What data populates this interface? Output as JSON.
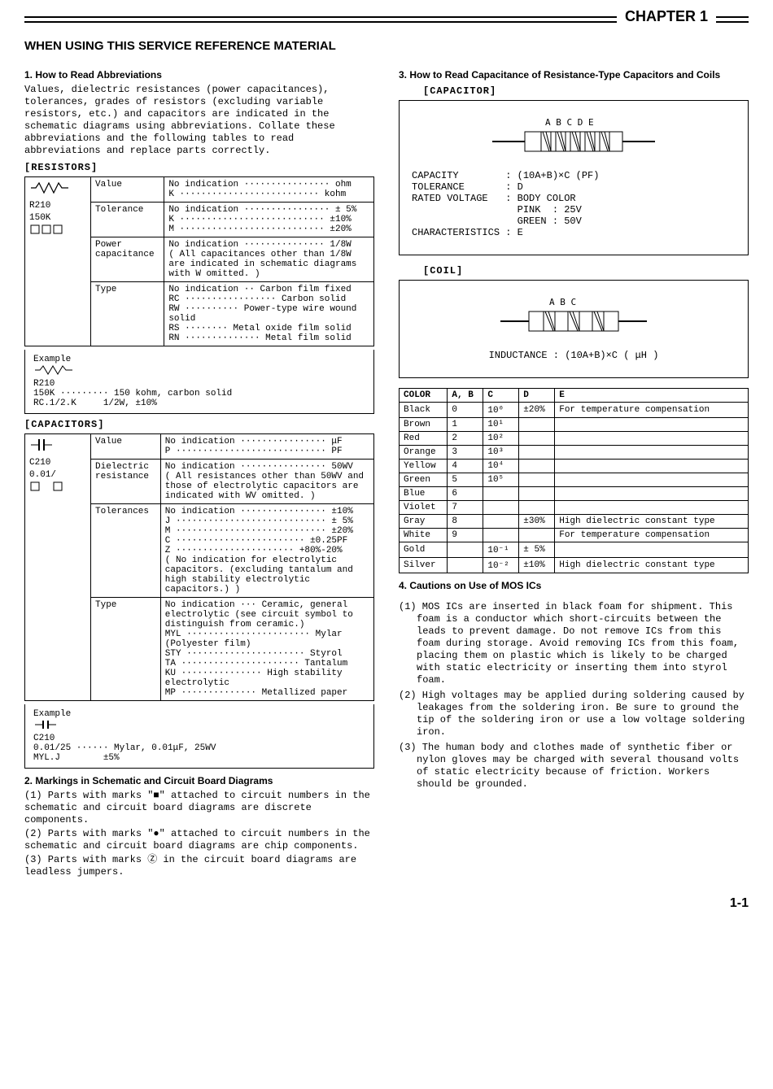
{
  "chapter": "CHAPTER 1",
  "main_title": "WHEN USING THIS SERVICE REFERENCE MATERIAL",
  "sec1": {
    "heading": "1. How to Read Abbreviations",
    "intro": "Values, dielectric resistances (power capacitances), tolerances, grades of resistors (excluding variable resistors, etc.) and capacitors are indicated in the schematic diagrams using abbreviations. Collate these abbreviations and the following tables to read abbreviations and replace parts correctly.",
    "resistors_label": "[RESISTORS]",
    "resistors_symbol": "R210\n150K",
    "resistors_rows": [
      {
        "k": "Value",
        "v": "No indication ················ ohm\nK ·························· kohm"
      },
      {
        "k": "Tolerance",
        "v": "No indication ················ ± 5%\nK ··························· ±10%\nM ··························· ±20%"
      },
      {
        "k": "Power capacitance",
        "v": "No indication ··············· 1/8W\n( All capacitances other than 1/8W are indicated in schematic diagrams with W omitted. )"
      },
      {
        "k": "Type",
        "v": "No indication ·· Carbon film fixed\nRC ················· Carbon solid\nRW ·········· Power-type wire wound solid\nRS ········ Metal oxide film solid\nRN ·············· Metal film solid"
      }
    ],
    "resistors_example_label": "Example",
    "resistors_example": "R210\n150K ········· 150 kohm, carbon solid\nRC.1/2.K     1/2W, ±10%",
    "capacitors_label": "[CAPACITORS]",
    "capacitors_symbol": "C210\n0.01/",
    "capacitors_rows": [
      {
        "k": "Value",
        "v": "No indication ················ μF\nP ···························· PF"
      },
      {
        "k": "Dielectric resistance",
        "v": "No indication ················ 50WV\n( All resistances other than 50WV and those of electrolytic capacitors are indicated with WV omitted. )"
      },
      {
        "k": "Tolerances",
        "v": "No indication ················ ±10%\nJ ···························· ± 5%\nM ···························· ±20%\nC ························ ±0.25PF\nZ ······················ +80%-20%\n( No indication for electrolytic capacitors. (excluding tantalum and high stability electrolytic capacitors.) )"
      },
      {
        "k": "Type",
        "v": "No indication ··· Ceramic, general electrolytic (see circuit symbol to distinguish from ceramic.)\nMYL ······················· Mylar (Polyester film)\nSTY ······················ Styrol\nTA ······················ Tantalum\nKU ··············· High stability electrolytic\nMP ·············· Metallized paper"
      }
    ],
    "capacitors_example_label": "Example",
    "capacitors_example": "C210\n0.01/25 ······ Mylar, 0.01μF, 25WV\nMYL.J        ±5%"
  },
  "sec2": {
    "heading": "2. Markings in Schematic and Circuit Board Diagrams",
    "items": [
      "(1) Parts with marks \"■\" attached to circuit numbers in the schematic and circuit board diagrams are discrete components.",
      "(2) Parts with marks \"●\" attached to circuit numbers in the schematic and circuit board diagrams are chip components.",
      "(3) Parts with marks Ⓩ in the circuit board diagrams are leadless jumpers."
    ]
  },
  "sec3": {
    "heading": "3. How to Read Capacitance of Resistance-Type Capacitors and Coils",
    "cap_label": "[CAPACITOR]",
    "cap_letters": [
      "A",
      "B",
      "C",
      "D",
      "E"
    ],
    "cap_lines": [
      "CAPACITY        : (10A+B)×C (PF)",
      "TOLERANCE       : D",
      "RATED VOLTAGE   : BODY COLOR",
      "                  PINK  : 25V",
      "                  GREEN : 50V",
      "CHARACTERISTICS : E"
    ],
    "coil_label": "[COIL]",
    "coil_letters": [
      "A",
      "B",
      "C"
    ],
    "coil_line": "INDUCTANCE : (10A+B)×C ( μH )",
    "color_table": {
      "headers": [
        "COLOR",
        "A, B",
        "C",
        "D",
        "E"
      ],
      "rows": [
        [
          "Black",
          "0",
          "10⁰",
          "±20%",
          "For temperature compensation"
        ],
        [
          "Brown",
          "1",
          "10¹",
          "",
          ""
        ],
        [
          "Red",
          "2",
          "10²",
          "",
          ""
        ],
        [
          "Orange",
          "3",
          "10³",
          "",
          ""
        ],
        [
          "Yellow",
          "4",
          "10⁴",
          "",
          ""
        ],
        [
          "Green",
          "5",
          "10⁵",
          "",
          ""
        ],
        [
          "Blue",
          "6",
          "",
          "",
          ""
        ],
        [
          "Violet",
          "7",
          "",
          "",
          ""
        ],
        [
          "Gray",
          "8",
          "",
          "±30%",
          "High dielectric constant type"
        ],
        [
          "White",
          "9",
          "",
          "",
          "For temperature compensation"
        ],
        [
          "Gold",
          "",
          "10⁻¹",
          "± 5%",
          ""
        ],
        [
          "Silver",
          "",
          "10⁻²",
          "±10%",
          "High dielectric constant type"
        ]
      ]
    }
  },
  "sec4": {
    "heading": "4. Cautions on Use of MOS ICs",
    "items": [
      "(1) MOS ICs are inserted in black foam for shipment. This foam is a conductor which short-circuits between the leads to prevent damage. Do not remove ICs from this foam during storage. Avoid removing ICs from this foam, placing them on plastic which is likely to be charged with static electricity or inserting them into styrol foam.",
      "(2) High voltages may be applied during soldering caused by leakages from the soldering iron. Be sure to ground the tip of the soldering iron or use a low voltage soldering iron.",
      "(3) The human body and clothes made of synthetic fiber or nylon gloves may be charged with several thousand volts of static electricity because of friction. Workers should be grounded."
    ]
  },
  "page_num": "1-1"
}
